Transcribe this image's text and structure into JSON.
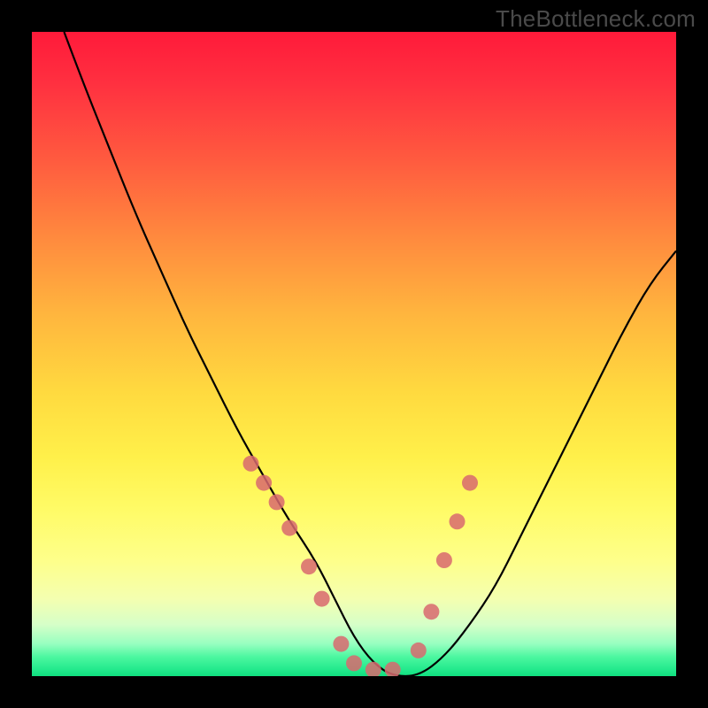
{
  "brand": "TheBottleneck.com",
  "chart_data": {
    "type": "line",
    "title": "",
    "xlabel": "",
    "ylabel": "",
    "xlim": [
      0,
      100
    ],
    "ylim": [
      0,
      100
    ],
    "series": [
      {
        "name": "bottleneck-curve",
        "x": [
          5,
          8,
          12,
          16,
          20,
          24,
          28,
          32,
          36,
          40,
          44,
          47,
          50,
          53,
          56,
          60,
          64,
          68,
          72,
          76,
          80,
          84,
          88,
          92,
          96,
          100
        ],
        "y": [
          100,
          92,
          82,
          72,
          63,
          54,
          46,
          38,
          31,
          24,
          18,
          12,
          6,
          2,
          0,
          0,
          3,
          8,
          14,
          22,
          30,
          38,
          46,
          54,
          61,
          66
        ]
      }
    ],
    "markers": {
      "name": "highlight-dots",
      "x": [
        34,
        36,
        38,
        40,
        43,
        45,
        48,
        50,
        53,
        56,
        60,
        62,
        64,
        66,
        68
      ],
      "y": [
        33,
        30,
        27,
        23,
        17,
        12,
        5,
        2,
        1,
        1,
        4,
        10,
        18,
        24,
        30
      ]
    },
    "gradient_stops": [
      {
        "pos": 0,
        "color": "#ff1a3a"
      },
      {
        "pos": 50,
        "color": "#ffd83f"
      },
      {
        "pos": 85,
        "color": "#feff8a"
      },
      {
        "pos": 100,
        "color": "#10df7f"
      }
    ]
  }
}
